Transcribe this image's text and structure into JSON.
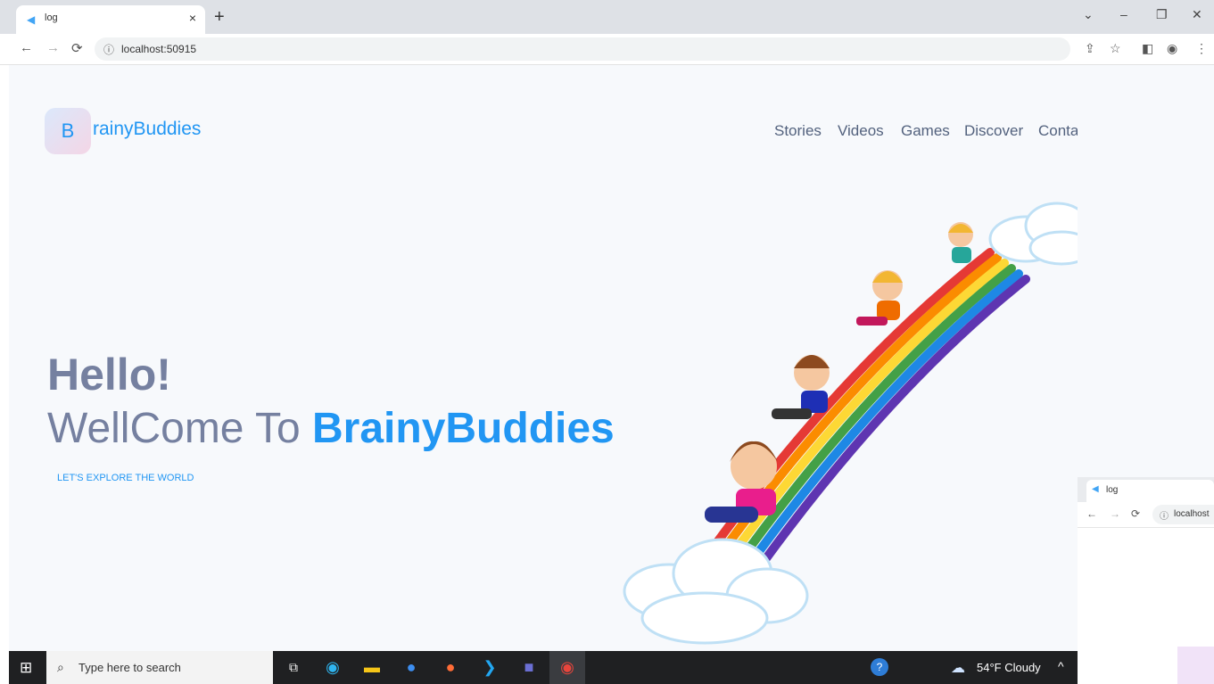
{
  "browser": {
    "tab_title": "log",
    "tab_favicon": "flutter-icon",
    "tab_close": "×",
    "new_tab": "+",
    "url": "localhost:50915",
    "window_controls": {
      "tab_search": "⌄",
      "minimize": "–",
      "restore": "❐",
      "close": "✕"
    },
    "nav": {
      "back": "←",
      "forward": "→",
      "reload": "⟳",
      "site_info": "ⓘ"
    },
    "toolbar_icons": {
      "share": "⇪",
      "star": "☆",
      "sidepanel": "◧",
      "profile": "◉",
      "menu": "⋮"
    }
  },
  "site": {
    "logo_letter": "B",
    "logo_text": "rainyBuddies",
    "nav": [
      "Stories",
      "Videos",
      "Games",
      "Discover",
      "Contact"
    ],
    "hero": {
      "hello": "Hello!",
      "welcome_prefix": "WellCome To ",
      "welcome_brand": "BrainyBuddies",
      "tagline": "LET'S EXPLORE THE WORLD"
    },
    "colors": {
      "brand_blue": "#2196f3",
      "heading_gray": "#7580a0",
      "nav_text": "#53627e",
      "page_bg": "#f7f9fc"
    }
  },
  "second_window": {
    "tab_title": "log",
    "url": "localhost"
  },
  "taskbar": {
    "search_placeholder": "Type here to search",
    "weather": "54°F  Cloudy",
    "apps": [
      "task-view-icon",
      "edge-icon",
      "file-explorer-icon",
      "app-store-icon",
      "postman-icon",
      "vscode-icon",
      "teams-icon",
      "chrome-icon"
    ]
  }
}
